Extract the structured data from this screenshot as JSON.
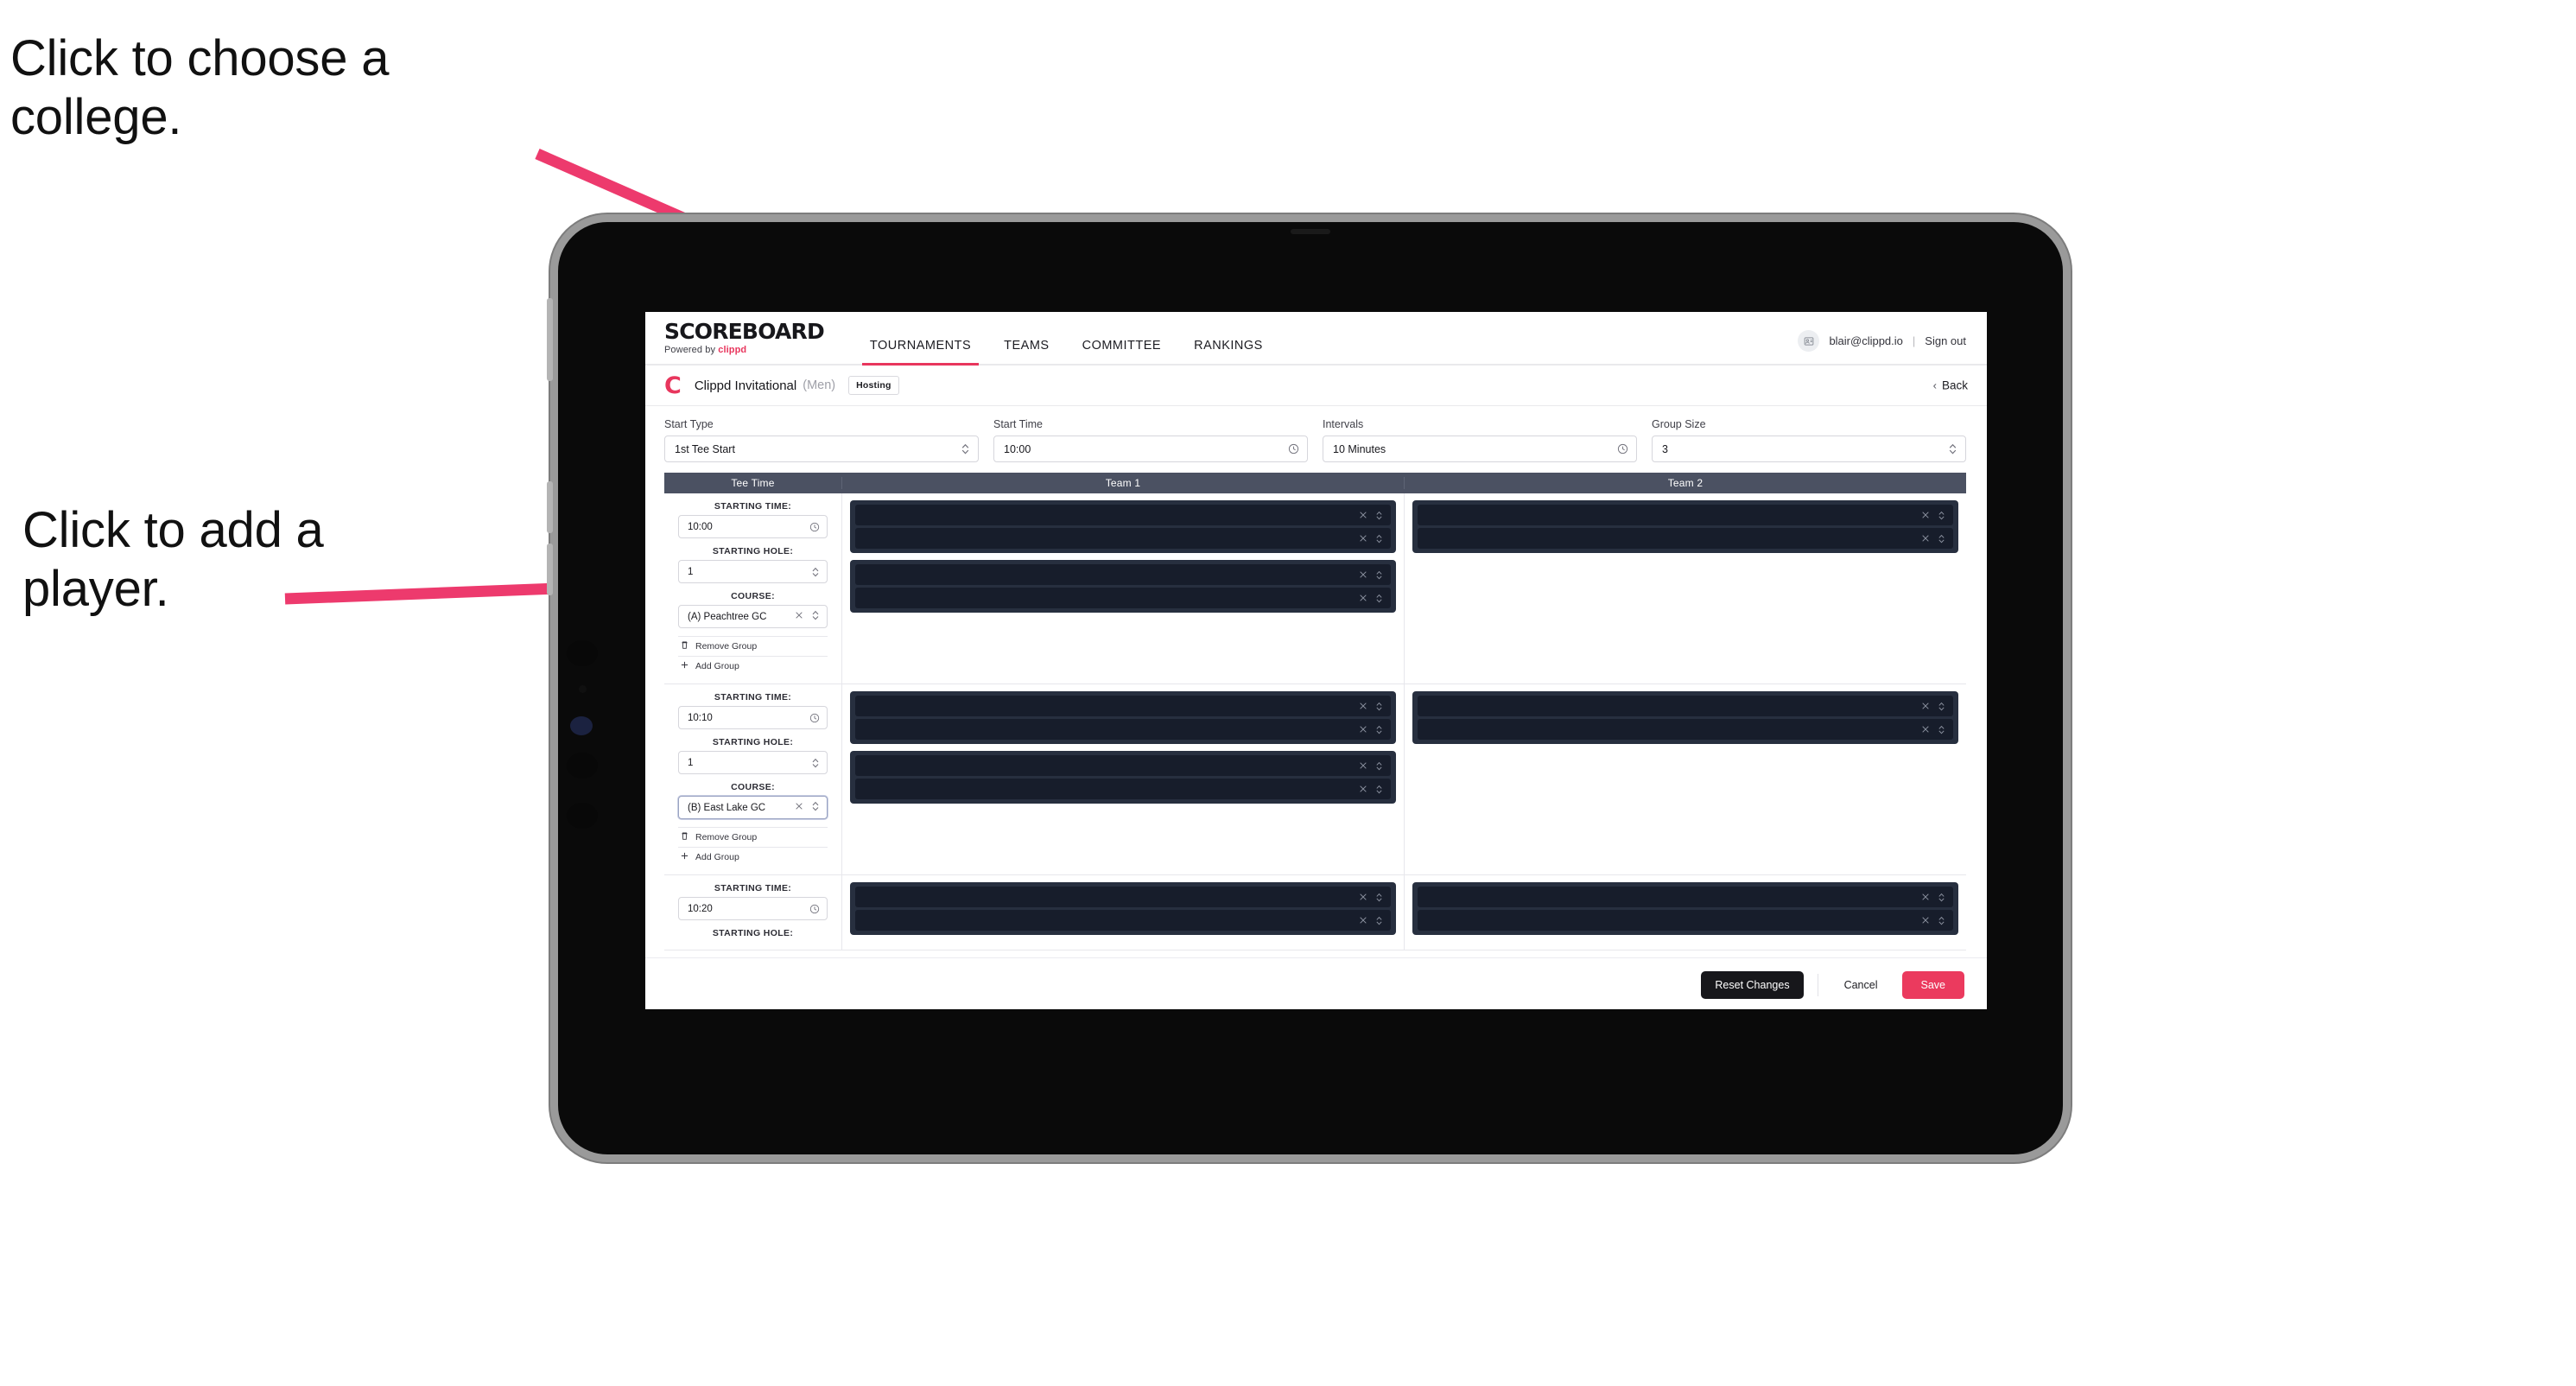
{
  "annotations": [
    {
      "id": "choose-college",
      "text": "Click to choose a college."
    },
    {
      "id": "add-player",
      "text": "Click to add a player."
    }
  ],
  "accent": "#e8365d",
  "header": {
    "brand_main": "SCOREBOARD",
    "brand_sub_prefix": "Powered by ",
    "brand_sub_accent": "clippd",
    "nav": [
      {
        "label": "TOURNAMENTS",
        "active": true
      },
      {
        "label": "TEAMS",
        "active": false
      },
      {
        "label": "COMMITTEE",
        "active": false
      },
      {
        "label": "RANKINGS",
        "active": false
      }
    ],
    "avatar_icon": "user-card-icon",
    "account_email": "blair@clippd.io",
    "separator": "|",
    "sign_out": "Sign out"
  },
  "tournament_bar": {
    "logo_letter": "C",
    "title": "Clippd Invitational",
    "gender": "(Men)",
    "badge": "Hosting",
    "back_label": "Back"
  },
  "controls": [
    {
      "name": "start-type",
      "label": "Start Type",
      "value": "1st Tee Start",
      "icon": "stepper-icon"
    },
    {
      "name": "start-time",
      "label": "Start Time",
      "value": "10:00",
      "icon": "clock-icon"
    },
    {
      "name": "intervals",
      "label": "Intervals",
      "value": "10 Minutes",
      "icon": "clock-icon"
    },
    {
      "name": "group-size",
      "label": "Group Size",
      "value": "3",
      "icon": "stepper-icon"
    }
  ],
  "table": {
    "columns": [
      "Tee Time",
      "Team 1",
      "Team 2"
    ],
    "field_labels": {
      "starting_time": "STARTING TIME:",
      "starting_hole": "STARTING HOLE:",
      "course": "COURSE:"
    },
    "group_actions": {
      "remove": "Remove Group",
      "add": "Add Group",
      "remove_icon": "trash-icon",
      "add_icon": "plus-icon"
    },
    "groups": [
      {
        "starting_time": "10:00",
        "starting_hole": "1",
        "course": "(A) Peachtree GC",
        "course_focused": false,
        "team1_cards": [
          {
            "slots": [
              "",
              ""
            ]
          },
          {
            "slots": [
              "",
              ""
            ]
          }
        ],
        "team2_cards": [
          {
            "slots": [
              "",
              ""
            ]
          }
        ]
      },
      {
        "starting_time": "10:10",
        "starting_hole": "1",
        "course": "(B) East Lake GC",
        "course_focused": true,
        "team1_cards": [
          {
            "slots": [
              "",
              ""
            ]
          },
          {
            "slots": [
              "",
              ""
            ]
          }
        ],
        "team2_cards": [
          {
            "slots": [
              "",
              ""
            ]
          }
        ]
      },
      {
        "starting_time": "10:20",
        "starting_hole": "",
        "course": "",
        "course_focused": false,
        "team1_cards": [
          {
            "slots": [
              "",
              ""
            ]
          }
        ],
        "team2_cards": [
          {
            "slots": [
              "",
              ""
            ]
          }
        ]
      }
    ],
    "slot_icons": {
      "clear": "x-icon",
      "dropdown": "chevron-updown-icon"
    }
  },
  "footer": {
    "reset_label": "Reset Changes",
    "cancel_label": "Cancel",
    "save_label": "Save"
  }
}
